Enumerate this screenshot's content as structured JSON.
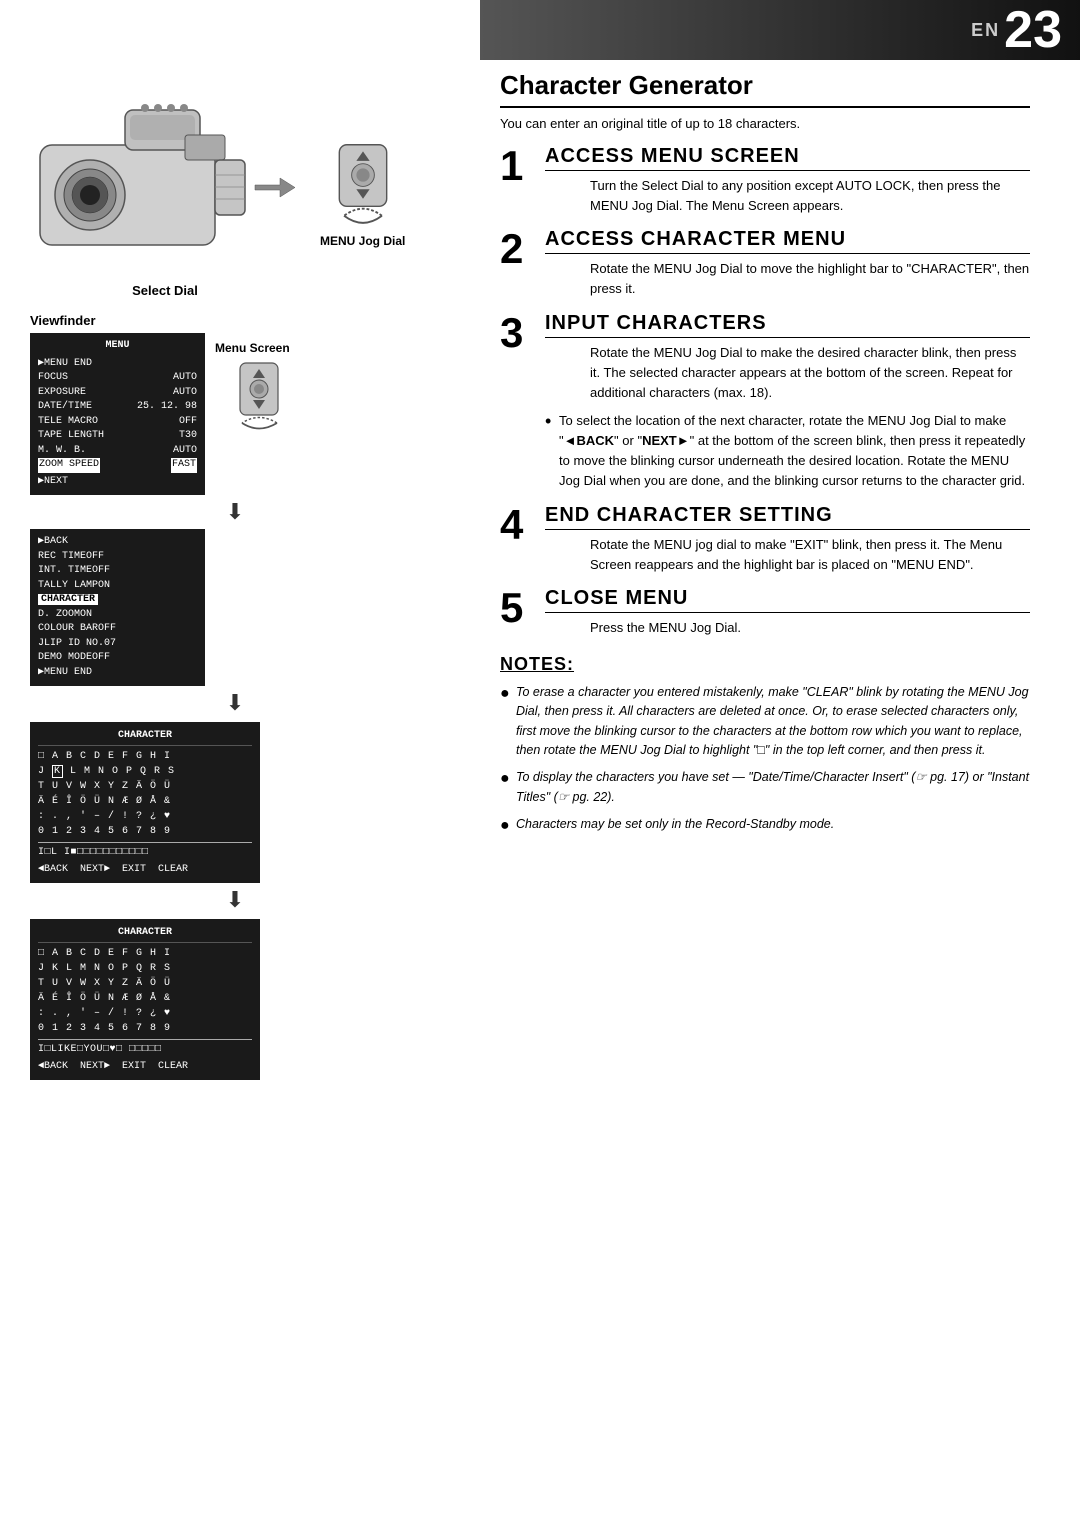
{
  "header": {
    "en_label": "EN",
    "page_number": "23"
  },
  "page_title": "Character Generator",
  "subtitle": "You can enter an original title of up to 18 characters.",
  "left": {
    "select_dial_label": "Select Dial",
    "menu_jog_label": "MENU Jog Dial",
    "viewfinder_label": "Viewfinder",
    "menu_screen_label": "Menu Screen",
    "menu_box1": {
      "title": "MENU",
      "rows": [
        {
          "label": "▶MENU END",
          "value": ""
        },
        {
          "label": "FOCUS",
          "value": "AUTO"
        },
        {
          "label": "EXPOSURE",
          "value": "AUTO"
        },
        {
          "label": "DATE/TIME",
          "value": "25. 12. 98"
        },
        {
          "label": "TELE  MACRO",
          "value": "OFF"
        },
        {
          "label": "TAPE  LENGTH",
          "value": "T30"
        },
        {
          "label": "M. W. B.",
          "value": "AUTO"
        },
        {
          "label": "ZOOM SPEED",
          "value": "FAST",
          "highlighted_label": "ZOOM SPEED",
          "highlighted_value": "FAST"
        },
        {
          "label": "▶NEXT",
          "value": ""
        }
      ]
    },
    "menu_box2": {
      "title": "",
      "rows": [
        {
          "label": "▶BACK",
          "value": ""
        },
        {
          "label": "REC TIME",
          "value": "OFF"
        },
        {
          "label": "INT. TIME",
          "value": "OFF"
        },
        {
          "label": "TALLY LAMP",
          "value": "ON"
        },
        {
          "label": "CHARACTER",
          "value": "",
          "highlighted": true
        },
        {
          "label": "D. ZOOM",
          "value": "ON"
        },
        {
          "label": "COLOUR BAR",
          "value": "OFF"
        },
        {
          "label": "JLIP ID NO.",
          "value": "07"
        },
        {
          "label": "DEMO MODE",
          "value": "OFF"
        },
        {
          "label": "▶MENU END",
          "value": ""
        }
      ]
    },
    "char_grid1": {
      "title": "CHARACTER",
      "rows": [
        "□  A  B  C  D  E  F  G  H  I",
        "J ·K· L  M  N  O  P  Q  R  S",
        "T  U  V  W  X  Y  Z  Ä  Ö  Ü",
        "Ä  É  Î  Ö  Ü  N  Æ  Ø  Å  &",
        ":  .  ,  '  –  /  !  ?  ¿  ♥",
        "0  1  2  3  4  5  6  7  8  9"
      ],
      "input_line": "I□L I■□□□□□□□□□□□",
      "nav_line": "◄BACK  NEXT►  EXIT  CLEAR"
    },
    "char_grid2": {
      "title": "CHARACTER",
      "rows": [
        "□  A  B  C  D  E  F  G  H  I",
        "J  K  L  M  N  O  P  Q  R  S",
        "T  U  V  W  X  Y  Z  Ä  Ö  Ü",
        "Ä  É  Î  Ö  Ü  N  Æ  Ø  Å  &",
        ":  .  ,  '  –  /  !  ?  ¿  ♥",
        "0  1  2  3  4  5  6  7  8  9"
      ],
      "input_line": "I□LIKE□YOU□♥□ □□□□□",
      "nav_line": "◄BACK  NEXT►  EXIT  CLEAR"
    }
  },
  "steps": [
    {
      "number": "1",
      "heading": "ACCESS MENU SCREEN",
      "body": "Turn the Select Dial to any position except AUTO LOCK, then press the MENU Jog Dial. The Menu Screen appears."
    },
    {
      "number": "2",
      "heading": "ACCESS CHARACTER MENU",
      "body": "Rotate the MENU Jog Dial to move the highlight bar to \"CHARACTER\", then press it."
    },
    {
      "number": "3",
      "heading": "INPUT CHARACTERS",
      "body": "Rotate the MENU Jog Dial to make the desired character blink, then press it. The selected character appears at the bottom of the screen. Repeat for additional characters (max. 18).",
      "bullet": "To select the location of the next character, rotate the MENU Jog Dial to make \"◄BACK\" or \"NEXT►\" at the bottom of the screen blink, then press it repeatedly to move the blinking cursor underneath the desired location. Rotate the MENU Jog Dial when you are done, and the blinking cursor returns to the character grid."
    },
    {
      "number": "4",
      "heading": "END CHARACTER SETTING",
      "body": "Rotate the MENU jog dial to make \"EXIT\" blink, then press it. The Menu Screen reappears and the highlight bar is placed on \"MENU END\"."
    },
    {
      "number": "5",
      "heading": "CLOSE MENU",
      "body": "Press the MENU Jog Dial."
    }
  ],
  "notes": {
    "heading": "NOTES:",
    "items": [
      "To erase a character you entered mistakenly, make \"CLEAR\" blink by rotating the MENU Jog Dial, then press it. All characters are deleted at once. Or, to erase selected characters only, first move the blinking cursor to the characters at the bottom row which you want to replace, then rotate the MENU Jog Dial to highlight \"□\" in the top left corner, and then press it.",
      "To display the characters you have set — \"Date/Time/Character Insert\" (☞ pg. 17) or \"Instant Titles\" (☞ pg. 22).",
      "Characters may be set only in the Record-Standby mode."
    ]
  }
}
